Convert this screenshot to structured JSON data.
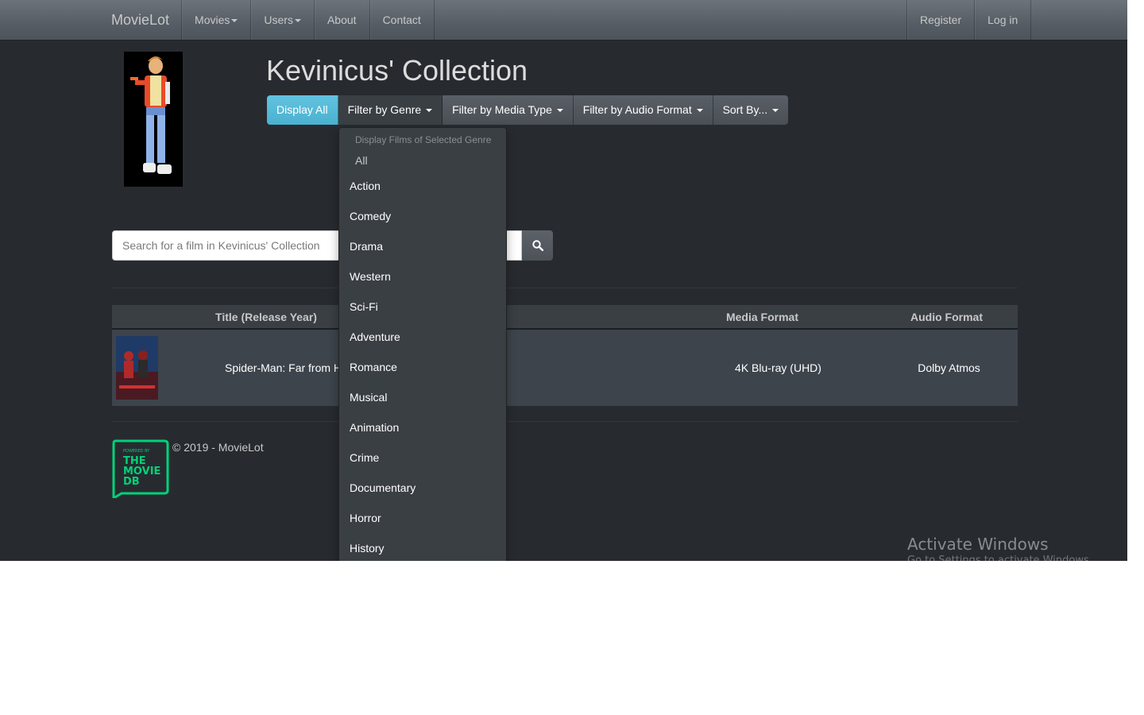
{
  "nav": {
    "brand": "MovieLot",
    "items": [
      "Movies",
      "Users",
      "About",
      "Contact"
    ],
    "right_items": [
      "Register",
      "Log in"
    ]
  },
  "header": {
    "title": "Kevinicus' Collection"
  },
  "filters": {
    "display_all": "Display All",
    "genre": "Filter by Genre",
    "media_type": "Filter by Media Type",
    "audio_format": "Filter by Audio Format",
    "sort": "Sort By..."
  },
  "genre_dropdown": {
    "header": "Display Films of Selected Genre",
    "all": "All",
    "items": [
      "Action",
      "Comedy",
      "Drama",
      "Western",
      "Sci-Fi",
      "Adventure",
      "Romance",
      "Musical",
      "Animation",
      "Crime",
      "Documentary",
      "Horror",
      "History"
    ]
  },
  "search": {
    "placeholder": "Search for a film in Kevinicus' Collection",
    "icon": "search-icon"
  },
  "table": {
    "columns": [
      "Title (Release Year)",
      "",
      "Media Format",
      "Audio Format"
    ],
    "rows": [
      {
        "title": "Spider-Man: Far from H",
        "media": "4K Blu-ray (UHD)",
        "audio": "Dolby Atmos"
      }
    ]
  },
  "footer": {
    "copyright": "© 2019 - MovieLot",
    "tmdb_logo": [
      "POWERED BY",
      "THE",
      "MOVIE",
      "DB"
    ]
  },
  "overlay": {
    "watermark": "Activate Windows",
    "watermark_sub": "Go to Settings to activate Windows."
  },
  "colors": {
    "background": "#272b30",
    "accent_info": "#5bc0de",
    "tmdb_green": "#01d277"
  }
}
